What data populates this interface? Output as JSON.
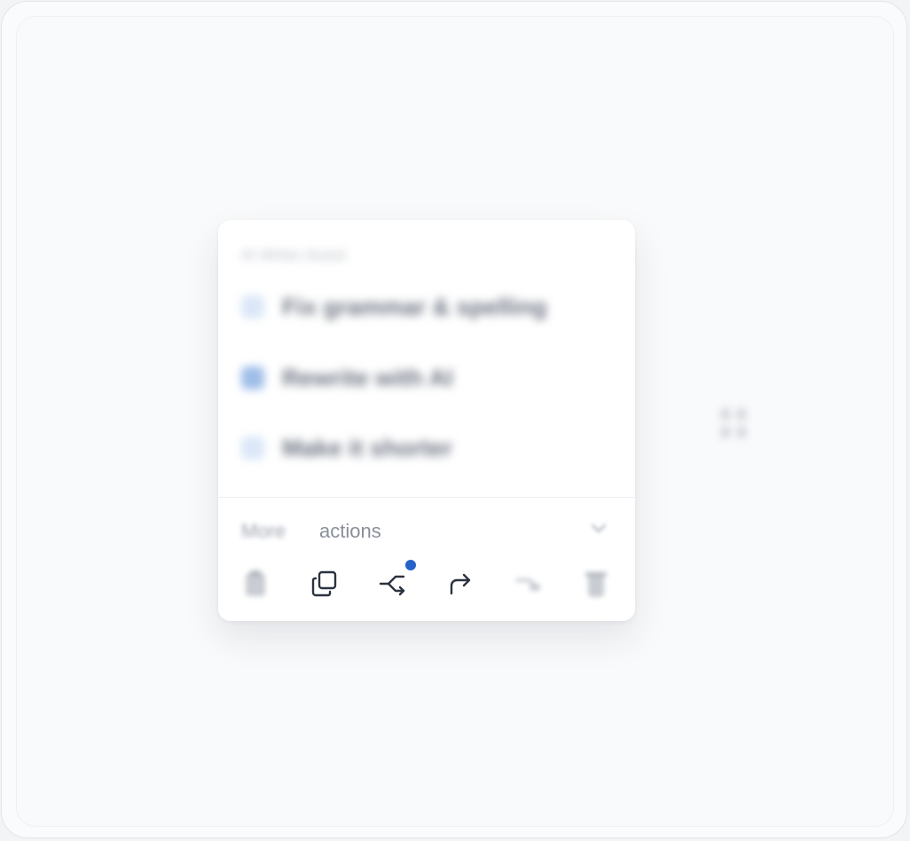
{
  "menu": {
    "section_title": "AI Writer Assist",
    "items": [
      {
        "label": "Fix grammar & spelling",
        "icon": "check-icon"
      },
      {
        "label": "Rewrite with AI",
        "icon": "edit-icon"
      },
      {
        "label": "Make it shorter",
        "icon": "shorten-icon"
      }
    ],
    "more_prefix": "More ",
    "more_suffix": "actions",
    "actions": [
      {
        "name": "clipboard-icon"
      },
      {
        "name": "copy-icon"
      },
      {
        "name": "branch-icon",
        "badge": true
      },
      {
        "name": "redo-icon"
      },
      {
        "name": "link-icon"
      },
      {
        "name": "trash-icon"
      }
    ]
  },
  "colors": {
    "accent": "#2563c9",
    "icon": "#2b3340",
    "muted": "#8a9099"
  }
}
